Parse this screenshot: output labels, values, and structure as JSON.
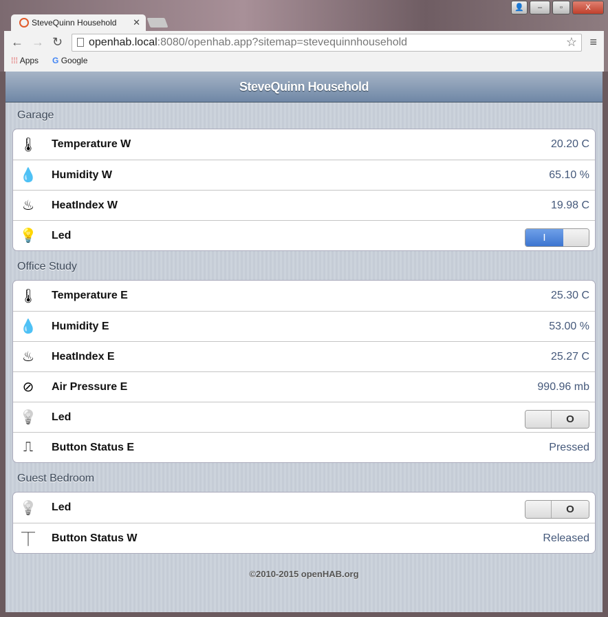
{
  "browser": {
    "tab_title": "SteveQuinn Household",
    "url_host": "openhab.local",
    "url_rest": ":8080/openhab.app?sitemap=stevequinnhousehold",
    "bookmarks": [
      "Apps",
      "Google"
    ]
  },
  "header": {
    "title": "SteveQuinn Household"
  },
  "sections": [
    {
      "title": "Garage",
      "rows": [
        {
          "icon": "thermometer-icon",
          "glyph": "🌡",
          "label": "Temperature W",
          "value": "20.20 C"
        },
        {
          "icon": "humidity-icon",
          "glyph": "💧",
          "label": "Humidity W",
          "value": "65.10 %"
        },
        {
          "icon": "heatindex-flame-icon",
          "glyph": "♨",
          "label": "HeatIndex W",
          "value": "19.98 C"
        },
        {
          "icon": "bulb-on-icon",
          "glyph": "💡",
          "label": "Led",
          "switch": "on",
          "switch_label": "I"
        }
      ]
    },
    {
      "title": "Office Study",
      "rows": [
        {
          "icon": "thermometer-icon",
          "glyph": "🌡",
          "label": "Temperature E",
          "value": "25.30 C"
        },
        {
          "icon": "humidity-icon",
          "glyph": "💧",
          "label": "Humidity E",
          "value": "53.00 %"
        },
        {
          "icon": "heatindex-flame-icon",
          "glyph": "♨",
          "label": "HeatIndex E",
          "value": "25.27 C"
        },
        {
          "icon": "pressure-gauge-icon",
          "glyph": "⊘",
          "label": "Air Pressure E",
          "value": "990.96 mb"
        },
        {
          "icon": "bulb-off-icon",
          "glyph": "💡",
          "label": "Led",
          "switch": "off",
          "switch_label": "O"
        },
        {
          "icon": "button-pressed-icon",
          "glyph": "⎍",
          "label": "Button Status E",
          "value": "Pressed"
        }
      ]
    },
    {
      "title": "Guest Bedroom",
      "rows": [
        {
          "icon": "bulb-off-icon",
          "glyph": "💡",
          "label": "Led",
          "switch": "off",
          "switch_label": "O"
        },
        {
          "icon": "button-released-icon",
          "glyph": "⏉",
          "label": "Button Status W",
          "value": "Released"
        }
      ]
    }
  ],
  "footer": "©2010-2015 openHAB.org"
}
